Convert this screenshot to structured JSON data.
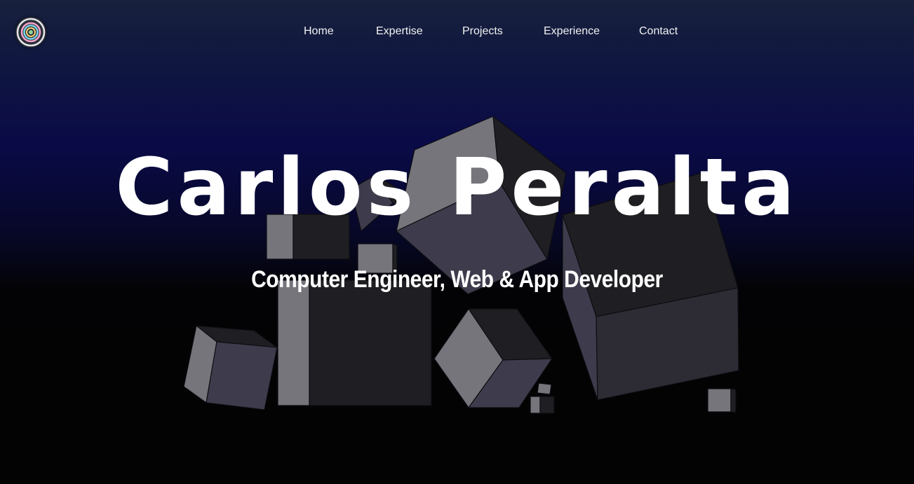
{
  "nav": {
    "logo_icon": "spiral-logo-icon",
    "items": [
      {
        "label": "Home"
      },
      {
        "label": "Expertise"
      },
      {
        "label": "Projects"
      },
      {
        "label": "Experience"
      },
      {
        "label": "Contact"
      }
    ]
  },
  "hero": {
    "title": "Carlos Peralta",
    "subtitle": "Computer Engineer, Web & App Developer"
  },
  "colors": {
    "background_top": "#17213d",
    "background_mid": "#0a0a47",
    "background_bottom": "#030303",
    "text": "#ffffff",
    "cube_light": "#76757c",
    "cube_dark": "#1f1f23",
    "cube_mid": "#3e3c4c"
  }
}
